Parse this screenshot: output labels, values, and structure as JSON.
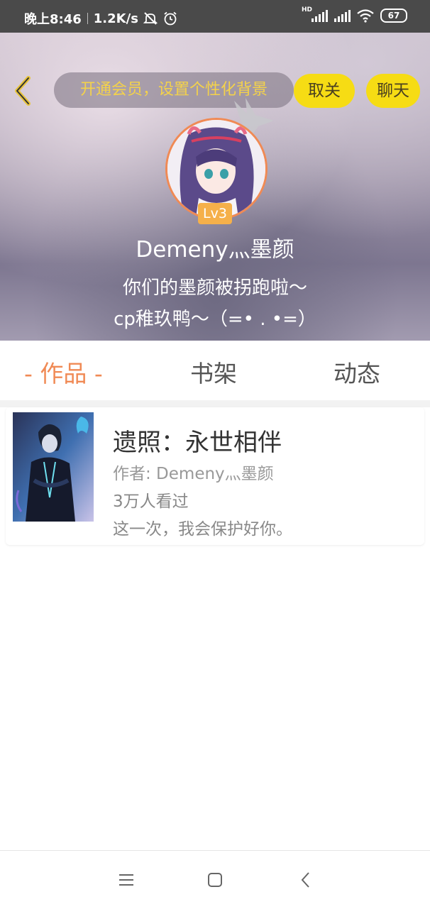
{
  "status_bar": {
    "time": "晚上8:46",
    "speed": "1.2K/s",
    "battery": "67",
    "hd_label": "HD"
  },
  "header": {
    "vip_prompt": "开通会员，设置个性化背景",
    "unfollow_label": "取关",
    "chat_label": "聊天",
    "level": "Lv3",
    "nickname": "Demeny灬墨颜",
    "signature_line1": "你们的墨颜被拐跑啦～",
    "signature_line2": "cp稚玖鸭～（=• . •=）"
  },
  "tabs": [
    {
      "label": "- 作品 -",
      "active": true
    },
    {
      "label": "书架",
      "active": false
    },
    {
      "label": "动态",
      "active": false
    }
  ],
  "book": {
    "title": "遗照：永世相伴",
    "author": "作者: Demeny灬墨颜",
    "views": "3万人看过",
    "description": "这一次，我会保护好你。"
  },
  "colors": {
    "accent": "#f08a55",
    "button_yellow": "#f6dc14",
    "vip_text": "#f4d24a",
    "level_badge": "#f5b04a"
  },
  "icons": [
    "back-icon",
    "crown-icon",
    "menu-icon",
    "home-icon",
    "nav-back-icon"
  ]
}
